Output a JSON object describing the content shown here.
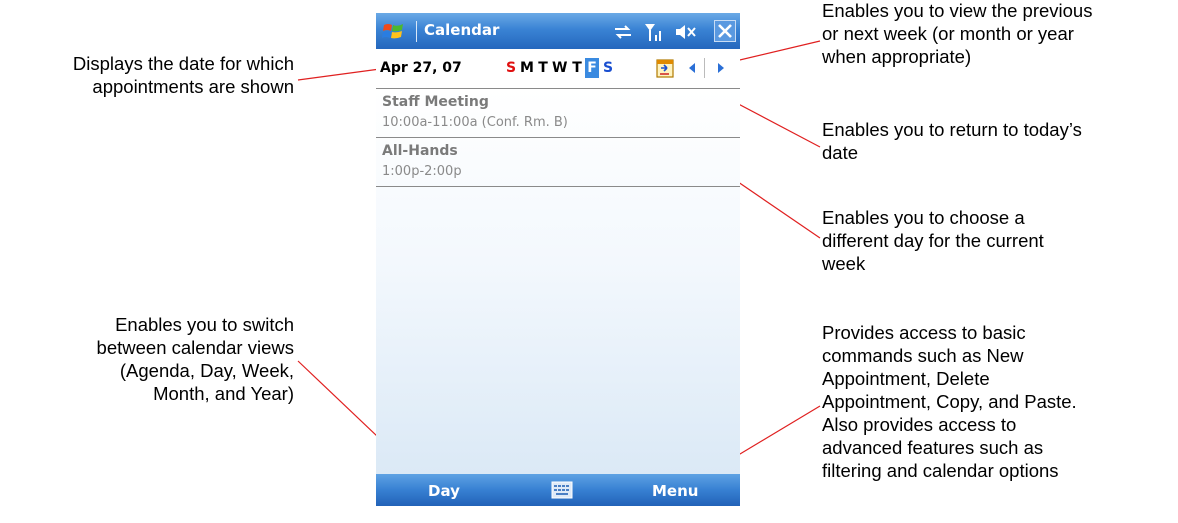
{
  "device": {
    "title": "Calendar",
    "date_label": "Apr 27, 07",
    "weekdays": [
      "S",
      "M",
      "T",
      "W",
      "T",
      "F",
      "S"
    ],
    "selected_weekday_index": 5,
    "appointments": [
      {
        "title": "Staff Meeting",
        "time": "10:00a-11:00a (Conf. Rm. B)"
      },
      {
        "title": "All-Hands",
        "time": "1:00p-2:00p"
      }
    ],
    "softkeys": {
      "left": "Day",
      "right": "Menu"
    },
    "icons": [
      "windows-flag-icon",
      "sync-arrows-icon",
      "signal-icon",
      "speaker-mute-icon",
      "close-icon",
      "today-icon",
      "previous-arrow-icon",
      "next-arrow-icon",
      "keyboard-icon"
    ]
  },
  "callouts": {
    "date": "Displays the date for which\nappointments are shown",
    "views": "Enables you to switch\nbetween calendar views\n(Agenda, Day, Week,\nMonth, and Year)",
    "prevnext": "Enables you to view the previous\nor next week (or month or year\nwhen appropriate)",
    "today": "Enables you to return to today’s\ndate",
    "day": "Enables you to choose a\ndifferent day for the current\nweek",
    "menu": "Provides access to basic\ncommands such as New\nAppointment, Delete\nAppointment, Copy, and Paste.\nAlso provides access to\nadvanced features such as\nfiltering and calendar options"
  },
  "colors": {
    "title_bar": "#3a83d4",
    "sunday": "#e01010",
    "saturday": "#1a4fd0",
    "selected_day_bg": "#3a8ae0",
    "leader_line": "#e02020"
  }
}
